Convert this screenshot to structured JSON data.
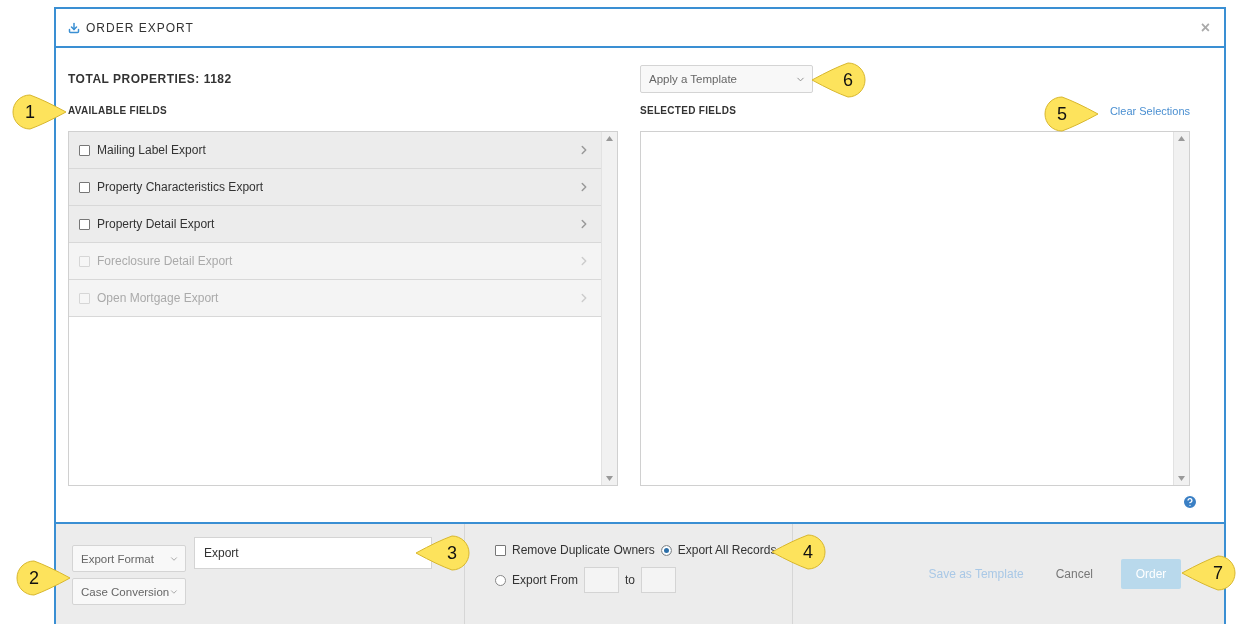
{
  "dialog": {
    "title": "ORDER EXPORT",
    "close": "×",
    "total": "TOTAL PROPERTIES: 1182",
    "template_select": "Apply a Template",
    "available": {
      "heading": "AVAILABLE FIELDS",
      "items": [
        {
          "label": "Mailing Label Export",
          "checked": false,
          "disabled": false
        },
        {
          "label": "Property Characteristics Export",
          "checked": false,
          "disabled": false
        },
        {
          "label": "Property Detail Export",
          "checked": false,
          "disabled": false
        },
        {
          "label": "Foreclosure Detail Export",
          "checked": false,
          "disabled": true
        },
        {
          "label": "Open Mortgage Export",
          "checked": false,
          "disabled": true
        }
      ]
    },
    "selected": {
      "heading": "SELECTED FIELDS",
      "clear_link": "Clear Selections"
    }
  },
  "footer": {
    "format_select": "Export Format",
    "case_select": "Case Conversion",
    "name_field": {
      "value": "Export"
    },
    "remove_duplicates": {
      "label": "Remove Duplicate Owners",
      "checked": false
    },
    "radios": [
      {
        "label": "Export All Records",
        "selected": true
      },
      {
        "label": "Export From",
        "selected": false
      }
    ],
    "range_to": "to",
    "save_template": {
      "label": "Save as Template",
      "disabled": true
    },
    "cancel": "Cancel",
    "order": {
      "label": "Order",
      "disabled": true
    }
  },
  "callouts": [
    {
      "number": "1",
      "kind": "right"
    },
    {
      "number": "2",
      "kind": "right"
    },
    {
      "number": "3",
      "kind": "left"
    },
    {
      "number": "4",
      "kind": "left"
    },
    {
      "number": "5",
      "kind": "right"
    },
    {
      "number": "6",
      "kind": "left"
    },
    {
      "number": "7",
      "kind": "left"
    }
  ]
}
